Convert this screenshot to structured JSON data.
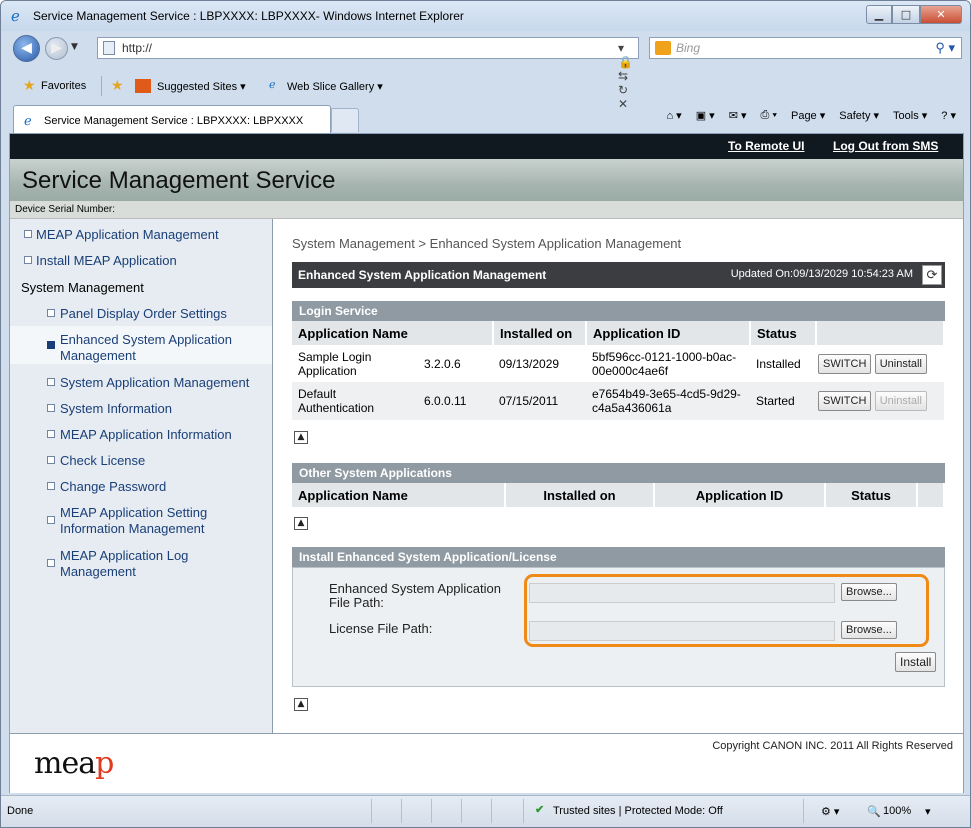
{
  "browser": {
    "window_title": "Service Management Service : LBPXXXX: LBPXXXX- Windows Internet Explorer",
    "address": "http://",
    "search_placeholder": "Bing",
    "favorites_label": "Favorites",
    "fav_links": [
      "Suggested Sites ▾",
      "Web Slice Gallery ▾"
    ],
    "tab_title": "Service Management Service : LBPXXXX: LBPXXXX",
    "commands": [
      "Page ▾",
      "Safety ▾",
      "Tools ▾",
      "? ▾"
    ],
    "status_left": "Done",
    "status_zone": "Trusted sites | Protected Mode: Off",
    "zoom": "100%"
  },
  "topbar": {
    "remote_ui": "To Remote UI",
    "logout": "Log Out from SMS"
  },
  "header": {
    "title": "Service Management Service",
    "serial_label": "Device Serial Number:"
  },
  "sidebar": {
    "items": [
      {
        "label": "MEAP Application Management"
      },
      {
        "label": "Install MEAP Application"
      },
      {
        "label": "System Management"
      },
      {
        "label": "Panel Display Order Settings"
      },
      {
        "label": "Enhanced System Application Management"
      },
      {
        "label": "System Application Management"
      },
      {
        "label": "System Information"
      },
      {
        "label": "MEAP Application Information"
      },
      {
        "label": "Check License"
      },
      {
        "label": "Change Password"
      },
      {
        "label": "MEAP Application Setting Information Management"
      },
      {
        "label": "MEAP Application Log Management"
      }
    ]
  },
  "main": {
    "breadcrumb": "System Management > Enhanced System Application Management",
    "title": "Enhanced System Application Management",
    "updated": "Updated On:09/13/2029 10:54:23 AM",
    "login_service": {
      "heading": "Login Service",
      "columns": [
        "Application Name",
        "Installed on",
        "Application ID",
        "Status"
      ],
      "rows": [
        {
          "name": "Sample Login Application",
          "version": "3.2.0.6",
          "installed": "09/13/2029",
          "app_id": "5bf596cc-0121-1000-b0ac-00e000c4ae6f",
          "status": "Installed",
          "switch": "SWITCH",
          "uninstall": "Uninstall"
        },
        {
          "name": "Default Authentication",
          "version": "6.0.0.11",
          "installed": "07/15/2011",
          "app_id": "e7654b49-3e65-4cd5-9d29-c4a5a436061a",
          "status": "Started",
          "switch": "SWITCH",
          "uninstall": "Uninstall"
        }
      ]
    },
    "other_apps": {
      "heading": "Other System Applications",
      "columns": [
        "Application Name",
        "Installed on",
        "Application ID",
        "Status"
      ]
    },
    "install": {
      "heading": "Install Enhanced System Application/License",
      "esa_label": "Enhanced System Application File Path:",
      "license_label": "License File Path:",
      "browse": "Browse...",
      "install_button": "Install"
    }
  },
  "footer": {
    "copyright": "Copyright CANON INC. 2011 All Rights Reserved",
    "logo": "meap"
  }
}
